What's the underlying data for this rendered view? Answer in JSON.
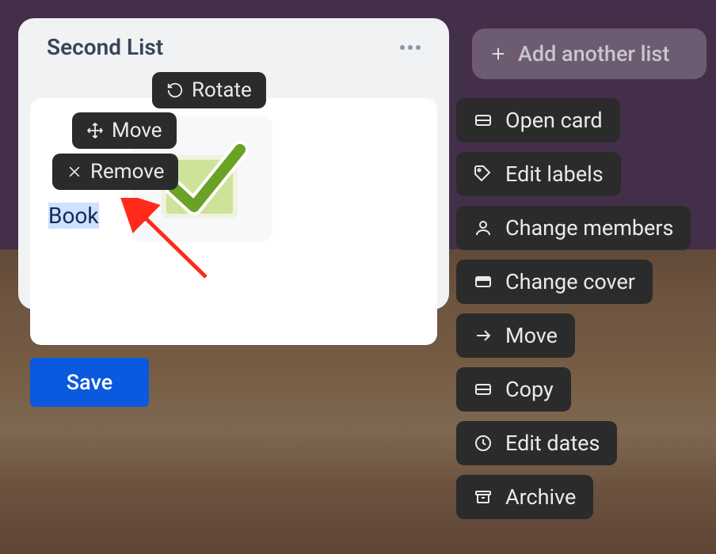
{
  "list": {
    "title": "Second List"
  },
  "image_controls": {
    "rotate": "Rotate",
    "move": "Move",
    "remove": "Remove"
  },
  "card": {
    "text": "Book",
    "save_label": "Save"
  },
  "add_list_label": "Add another list",
  "actions": {
    "open_card": "Open card",
    "edit_labels": "Edit labels",
    "change_members": "Change members",
    "change_cover": "Change cover",
    "move": "Move",
    "copy": "Copy",
    "edit_dates": "Edit dates",
    "archive": "Archive"
  }
}
